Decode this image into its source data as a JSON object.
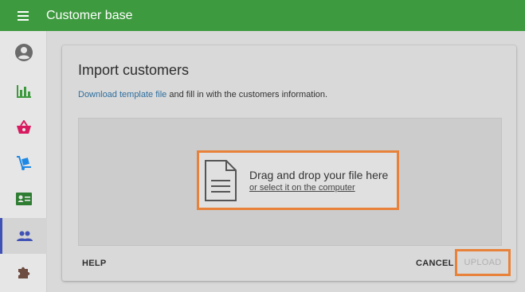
{
  "appbar": {
    "title": "Customer base",
    "bg_color": "#3e9a3f",
    "menu_icon": "hamburger-icon"
  },
  "sidebar": {
    "items": [
      {
        "icon": "account-circle-icon",
        "color": "#6b6b6b"
      },
      {
        "icon": "bar-chart-icon",
        "color": "#3e9a3f"
      },
      {
        "icon": "shopping-basket-icon",
        "color": "#d81b60"
      },
      {
        "icon": "dolly-icon",
        "color": "#1e88e5"
      },
      {
        "icon": "contact-card-icon",
        "color": "#2e7d32"
      },
      {
        "icon": "people-icon",
        "color": "#3f51b5",
        "active": true
      },
      {
        "icon": "puzzle-icon",
        "color": "#6d4c41"
      }
    ]
  },
  "import_card": {
    "title": "Import customers",
    "template_link": "Download template file",
    "subtitle_rest": "and fill in with the customers information.",
    "dropzone": {
      "main_text": "Drag and drop your file here",
      "link_text": "or select it on the computer",
      "icon": "file-document-icon"
    },
    "actions": {
      "help": "HELP",
      "cancel": "CANCEL",
      "upload": "UPLOAD"
    }
  },
  "colors": {
    "link": "#2f6f9f",
    "highlight": "#e8823a"
  }
}
